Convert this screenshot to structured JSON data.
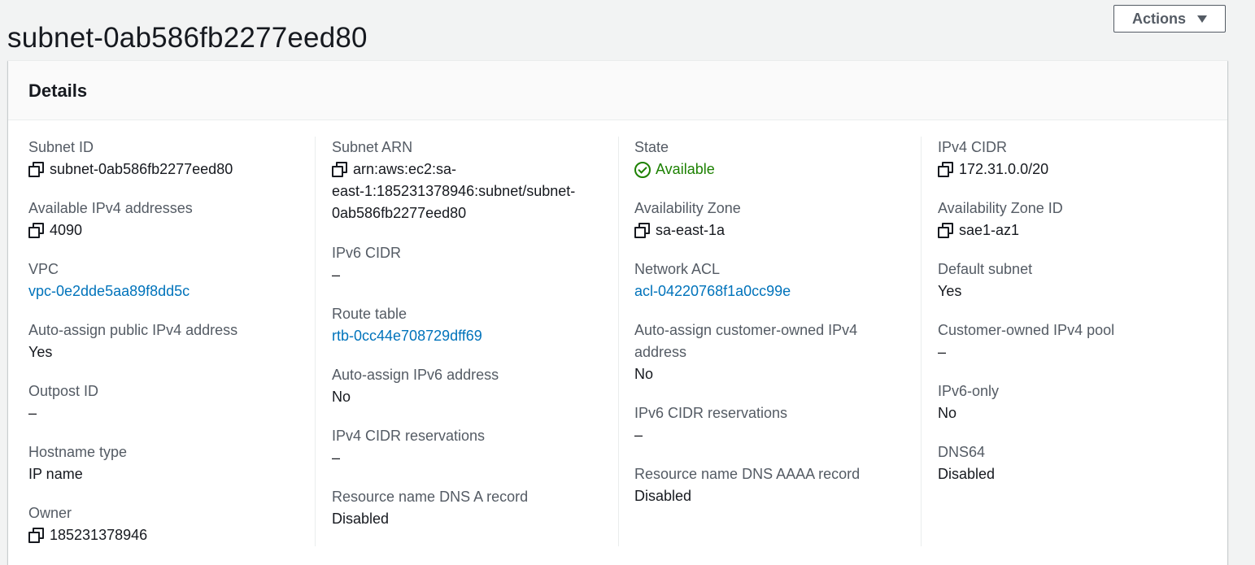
{
  "page": {
    "title": "subnet-0ab586fb2277eed80",
    "actions_label": "Actions"
  },
  "panel": {
    "title": "Details"
  },
  "col1": {
    "subnet_id_label": "Subnet ID",
    "subnet_id_value": "subnet-0ab586fb2277eed80",
    "available_ipv4_label": "Available IPv4 addresses",
    "available_ipv4_value": "4090",
    "vpc_label": "VPC",
    "vpc_value": "vpc-0e2dde5aa89f8dd5c",
    "auto_assign_public_ipv4_label": "Auto-assign public IPv4 address",
    "auto_assign_public_ipv4_value": "Yes",
    "outpost_id_label": "Outpost ID",
    "outpost_id_value": "–",
    "hostname_type_label": "Hostname type",
    "hostname_type_value": "IP name",
    "owner_label": "Owner",
    "owner_value": "185231378946"
  },
  "col2": {
    "subnet_arn_label": "Subnet ARN",
    "subnet_arn_line1": "arn:aws:ec2:sa-",
    "subnet_arn_line2": "east-1:185231378946:subnet/subnet-",
    "subnet_arn_line3": "0ab586fb2277eed80",
    "ipv6_cidr_label": "IPv6 CIDR",
    "ipv6_cidr_value": "–",
    "route_table_label": "Route table",
    "route_table_value": "rtb-0cc44e708729dff69",
    "auto_assign_ipv6_label": "Auto-assign IPv6 address",
    "auto_assign_ipv6_value": "No",
    "ipv4_cidr_reservations_label": "IPv4 CIDR reservations",
    "ipv4_cidr_reservations_value": "–",
    "dns_a_record_label": "Resource name DNS A record",
    "dns_a_record_value": "Disabled"
  },
  "col3": {
    "state_label": "State",
    "state_value": "Available",
    "availability_zone_label": "Availability Zone",
    "availability_zone_value": "sa-east-1a",
    "network_acl_label": "Network ACL",
    "network_acl_value": "acl-04220768f1a0cc99e",
    "auto_assign_customer_owned_label_line1": "Auto-assign customer-owned IPv4",
    "auto_assign_customer_owned_label_line2": "address",
    "auto_assign_customer_owned_value": "No",
    "ipv6_cidr_reservations_label": "IPv6 CIDR reservations",
    "ipv6_cidr_reservations_value": "–",
    "dns_aaaa_record_label": "Resource name DNS AAAA record",
    "dns_aaaa_record_value": "Disabled"
  },
  "col4": {
    "ipv4_cidr_label": "IPv4 CIDR",
    "ipv4_cidr_value": "172.31.0.0/20",
    "availability_zone_id_label": "Availability Zone ID",
    "availability_zone_id_value": "sae1-az1",
    "default_subnet_label": "Default subnet",
    "default_subnet_value": "Yes",
    "customer_owned_ipv4_pool_label": "Customer-owned IPv4 pool",
    "customer_owned_ipv4_pool_value": "–",
    "ipv6_only_label": "IPv6-only",
    "ipv6_only_value": "No",
    "dns64_label": "DNS64",
    "dns64_value": "Disabled"
  },
  "colors": {
    "link": "#0073bb",
    "success": "#1d8102",
    "label": "#545b64",
    "text": "#16191f"
  },
  "icons": [
    "copy-icon",
    "check-circle-icon",
    "caret-down-icon"
  ]
}
